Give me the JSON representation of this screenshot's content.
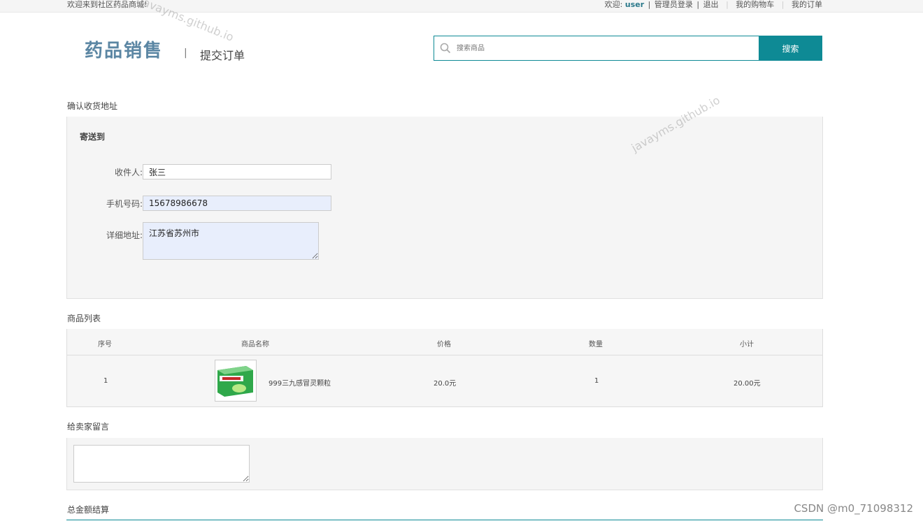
{
  "topbar": {
    "welcome": "欢迎来到社区药品商城!",
    "greeting": "欢迎:",
    "username": "user",
    "admin_login": "管理员登录",
    "logout": "退出",
    "cart": "我的购物车",
    "orders": "我的订单"
  },
  "header": {
    "logo": "药品销售",
    "divider": "|",
    "subtitle": "提交订单"
  },
  "search": {
    "placeholder": "搜索商品",
    "button": "搜索"
  },
  "address": {
    "section_title": "确认收货地址",
    "ship_to": "寄送到",
    "recipient_label": "收件人:",
    "recipient_value": "张三",
    "phone_label": "手机号码:",
    "phone_value": "15678986678",
    "detail_label": "详细地址:",
    "detail_value": "江苏省苏州市"
  },
  "products": {
    "section_title": "商品列表",
    "headers": [
      "序号",
      "商品名称",
      "价格",
      "数量",
      "小计"
    ],
    "rows": [
      {
        "index": "1",
        "name": "999三九感冒灵颗粒",
        "price": "20.0元",
        "qty": "1",
        "subtotal": "20.00元"
      }
    ]
  },
  "message": {
    "section_title": "给卖家留言",
    "value": ""
  },
  "total": {
    "section_title": "总金额结算"
  },
  "watermarks": {
    "site": "javayms.github.io",
    "csdn": "CSDN @m0_71098312"
  },
  "colors": {
    "accent": "#0e8a95",
    "logo": "#5b86a3",
    "input_filled_bg": "#e8eefc"
  }
}
